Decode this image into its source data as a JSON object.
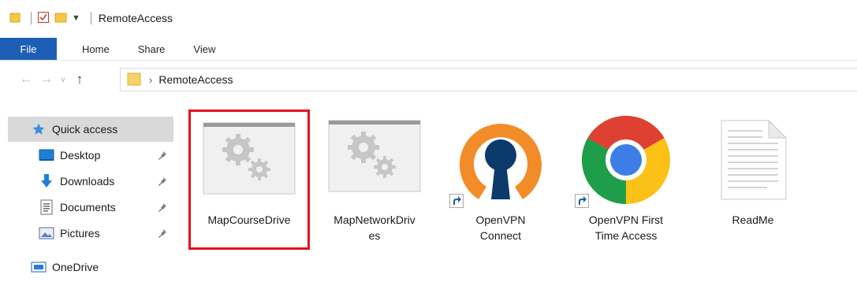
{
  "window": {
    "title": "RemoteAccess"
  },
  "ribbon": {
    "tabs": [
      "File",
      "Home",
      "Share",
      "View"
    ]
  },
  "address": {
    "path": "RemoteAccess"
  },
  "navpane": {
    "quick_access": "Quick access",
    "items": [
      {
        "label": "Desktop",
        "icon": "desktop-icon",
        "pinned": true
      },
      {
        "label": "Downloads",
        "icon": "downloads-icon",
        "pinned": true
      },
      {
        "label": "Documents",
        "icon": "documents-icon",
        "pinned": true
      },
      {
        "label": "Pictures",
        "icon": "pictures-icon",
        "pinned": true
      }
    ],
    "onedrive": "OneDrive"
  },
  "files": [
    {
      "name": "MapCourseDrive",
      "icon": "script-gears-icon",
      "selected_highlight": true
    },
    {
      "name": "MapNetworkDrives",
      "display": [
        "MapNetworkDriv",
        "es"
      ],
      "icon": "script-gears-icon"
    },
    {
      "name": "OpenVPN Connect",
      "display": [
        "OpenVPN",
        "Connect"
      ],
      "icon": "openvpn-icon",
      "shortcut": true
    },
    {
      "name": "OpenVPN First Time Access",
      "display": [
        "OpenVPN First",
        "Time Access"
      ],
      "icon": "chrome-icon",
      "shortcut": true
    },
    {
      "name": "ReadMe",
      "icon": "text-document-icon"
    }
  ],
  "colors": {
    "file_tab": "#1c5fb5",
    "highlight": "#e0141e",
    "selected_nav": "#d9d9d9",
    "openvpn_orange": "#f28c28",
    "openvpn_navy": "#0b3a6b"
  }
}
